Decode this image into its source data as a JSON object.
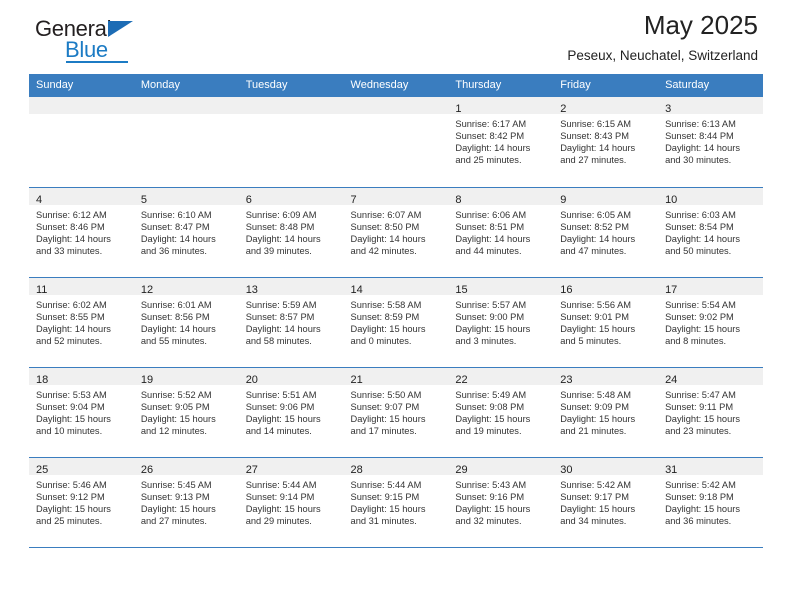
{
  "brand": {
    "name_part1": "General",
    "name_part2": "Blue",
    "logo_icon": "triangle-icon"
  },
  "header": {
    "title": "May 2025",
    "subtitle": "Peseux, Neuchatel, Switzerland",
    "accent_color": "#3a7dbf"
  },
  "weekdays": [
    "Sunday",
    "Monday",
    "Tuesday",
    "Wednesday",
    "Thursday",
    "Friday",
    "Saturday"
  ],
  "weeks": [
    [
      {
        "day": "",
        "sunrise": "",
        "sunset": "",
        "daylight_1": "",
        "daylight_2": ""
      },
      {
        "day": "",
        "sunrise": "",
        "sunset": "",
        "daylight_1": "",
        "daylight_2": ""
      },
      {
        "day": "",
        "sunrise": "",
        "sunset": "",
        "daylight_1": "",
        "daylight_2": ""
      },
      {
        "day": "",
        "sunrise": "",
        "sunset": "",
        "daylight_1": "",
        "daylight_2": ""
      },
      {
        "day": "1",
        "sunrise": "Sunrise: 6:17 AM",
        "sunset": "Sunset: 8:42 PM",
        "daylight_1": "Daylight: 14 hours",
        "daylight_2": "and 25 minutes."
      },
      {
        "day": "2",
        "sunrise": "Sunrise: 6:15 AM",
        "sunset": "Sunset: 8:43 PM",
        "daylight_1": "Daylight: 14 hours",
        "daylight_2": "and 27 minutes."
      },
      {
        "day": "3",
        "sunrise": "Sunrise: 6:13 AM",
        "sunset": "Sunset: 8:44 PM",
        "daylight_1": "Daylight: 14 hours",
        "daylight_2": "and 30 minutes."
      }
    ],
    [
      {
        "day": "4",
        "sunrise": "Sunrise: 6:12 AM",
        "sunset": "Sunset: 8:46 PM",
        "daylight_1": "Daylight: 14 hours",
        "daylight_2": "and 33 minutes."
      },
      {
        "day": "5",
        "sunrise": "Sunrise: 6:10 AM",
        "sunset": "Sunset: 8:47 PM",
        "daylight_1": "Daylight: 14 hours",
        "daylight_2": "and 36 minutes."
      },
      {
        "day": "6",
        "sunrise": "Sunrise: 6:09 AM",
        "sunset": "Sunset: 8:48 PM",
        "daylight_1": "Daylight: 14 hours",
        "daylight_2": "and 39 minutes."
      },
      {
        "day": "7",
        "sunrise": "Sunrise: 6:07 AM",
        "sunset": "Sunset: 8:50 PM",
        "daylight_1": "Daylight: 14 hours",
        "daylight_2": "and 42 minutes."
      },
      {
        "day": "8",
        "sunrise": "Sunrise: 6:06 AM",
        "sunset": "Sunset: 8:51 PM",
        "daylight_1": "Daylight: 14 hours",
        "daylight_2": "and 44 minutes."
      },
      {
        "day": "9",
        "sunrise": "Sunrise: 6:05 AM",
        "sunset": "Sunset: 8:52 PM",
        "daylight_1": "Daylight: 14 hours",
        "daylight_2": "and 47 minutes."
      },
      {
        "day": "10",
        "sunrise": "Sunrise: 6:03 AM",
        "sunset": "Sunset: 8:54 PM",
        "daylight_1": "Daylight: 14 hours",
        "daylight_2": "and 50 minutes."
      }
    ],
    [
      {
        "day": "11",
        "sunrise": "Sunrise: 6:02 AM",
        "sunset": "Sunset: 8:55 PM",
        "daylight_1": "Daylight: 14 hours",
        "daylight_2": "and 52 minutes."
      },
      {
        "day": "12",
        "sunrise": "Sunrise: 6:01 AM",
        "sunset": "Sunset: 8:56 PM",
        "daylight_1": "Daylight: 14 hours",
        "daylight_2": "and 55 minutes."
      },
      {
        "day": "13",
        "sunrise": "Sunrise: 5:59 AM",
        "sunset": "Sunset: 8:57 PM",
        "daylight_1": "Daylight: 14 hours",
        "daylight_2": "and 58 minutes."
      },
      {
        "day": "14",
        "sunrise": "Sunrise: 5:58 AM",
        "sunset": "Sunset: 8:59 PM",
        "daylight_1": "Daylight: 15 hours",
        "daylight_2": "and 0 minutes."
      },
      {
        "day": "15",
        "sunrise": "Sunrise: 5:57 AM",
        "sunset": "Sunset: 9:00 PM",
        "daylight_1": "Daylight: 15 hours",
        "daylight_2": "and 3 minutes."
      },
      {
        "day": "16",
        "sunrise": "Sunrise: 5:56 AM",
        "sunset": "Sunset: 9:01 PM",
        "daylight_1": "Daylight: 15 hours",
        "daylight_2": "and 5 minutes."
      },
      {
        "day": "17",
        "sunrise": "Sunrise: 5:54 AM",
        "sunset": "Sunset: 9:02 PM",
        "daylight_1": "Daylight: 15 hours",
        "daylight_2": "and 8 minutes."
      }
    ],
    [
      {
        "day": "18",
        "sunrise": "Sunrise: 5:53 AM",
        "sunset": "Sunset: 9:04 PM",
        "daylight_1": "Daylight: 15 hours",
        "daylight_2": "and 10 minutes."
      },
      {
        "day": "19",
        "sunrise": "Sunrise: 5:52 AM",
        "sunset": "Sunset: 9:05 PM",
        "daylight_1": "Daylight: 15 hours",
        "daylight_2": "and 12 minutes."
      },
      {
        "day": "20",
        "sunrise": "Sunrise: 5:51 AM",
        "sunset": "Sunset: 9:06 PM",
        "daylight_1": "Daylight: 15 hours",
        "daylight_2": "and 14 minutes."
      },
      {
        "day": "21",
        "sunrise": "Sunrise: 5:50 AM",
        "sunset": "Sunset: 9:07 PM",
        "daylight_1": "Daylight: 15 hours",
        "daylight_2": "and 17 minutes."
      },
      {
        "day": "22",
        "sunrise": "Sunrise: 5:49 AM",
        "sunset": "Sunset: 9:08 PM",
        "daylight_1": "Daylight: 15 hours",
        "daylight_2": "and 19 minutes."
      },
      {
        "day": "23",
        "sunrise": "Sunrise: 5:48 AM",
        "sunset": "Sunset: 9:09 PM",
        "daylight_1": "Daylight: 15 hours",
        "daylight_2": "and 21 minutes."
      },
      {
        "day": "24",
        "sunrise": "Sunrise: 5:47 AM",
        "sunset": "Sunset: 9:11 PM",
        "daylight_1": "Daylight: 15 hours",
        "daylight_2": "and 23 minutes."
      }
    ],
    [
      {
        "day": "25",
        "sunrise": "Sunrise: 5:46 AM",
        "sunset": "Sunset: 9:12 PM",
        "daylight_1": "Daylight: 15 hours",
        "daylight_2": "and 25 minutes."
      },
      {
        "day": "26",
        "sunrise": "Sunrise: 5:45 AM",
        "sunset": "Sunset: 9:13 PM",
        "daylight_1": "Daylight: 15 hours",
        "daylight_2": "and 27 minutes."
      },
      {
        "day": "27",
        "sunrise": "Sunrise: 5:44 AM",
        "sunset": "Sunset: 9:14 PM",
        "daylight_1": "Daylight: 15 hours",
        "daylight_2": "and 29 minutes."
      },
      {
        "day": "28",
        "sunrise": "Sunrise: 5:44 AM",
        "sunset": "Sunset: 9:15 PM",
        "daylight_1": "Daylight: 15 hours",
        "daylight_2": "and 31 minutes."
      },
      {
        "day": "29",
        "sunrise": "Sunrise: 5:43 AM",
        "sunset": "Sunset: 9:16 PM",
        "daylight_1": "Daylight: 15 hours",
        "daylight_2": "and 32 minutes."
      },
      {
        "day": "30",
        "sunrise": "Sunrise: 5:42 AM",
        "sunset": "Sunset: 9:17 PM",
        "daylight_1": "Daylight: 15 hours",
        "daylight_2": "and 34 minutes."
      },
      {
        "day": "31",
        "sunrise": "Sunrise: 5:42 AM",
        "sunset": "Sunset: 9:18 PM",
        "daylight_1": "Daylight: 15 hours",
        "daylight_2": "and 36 minutes."
      }
    ]
  ]
}
